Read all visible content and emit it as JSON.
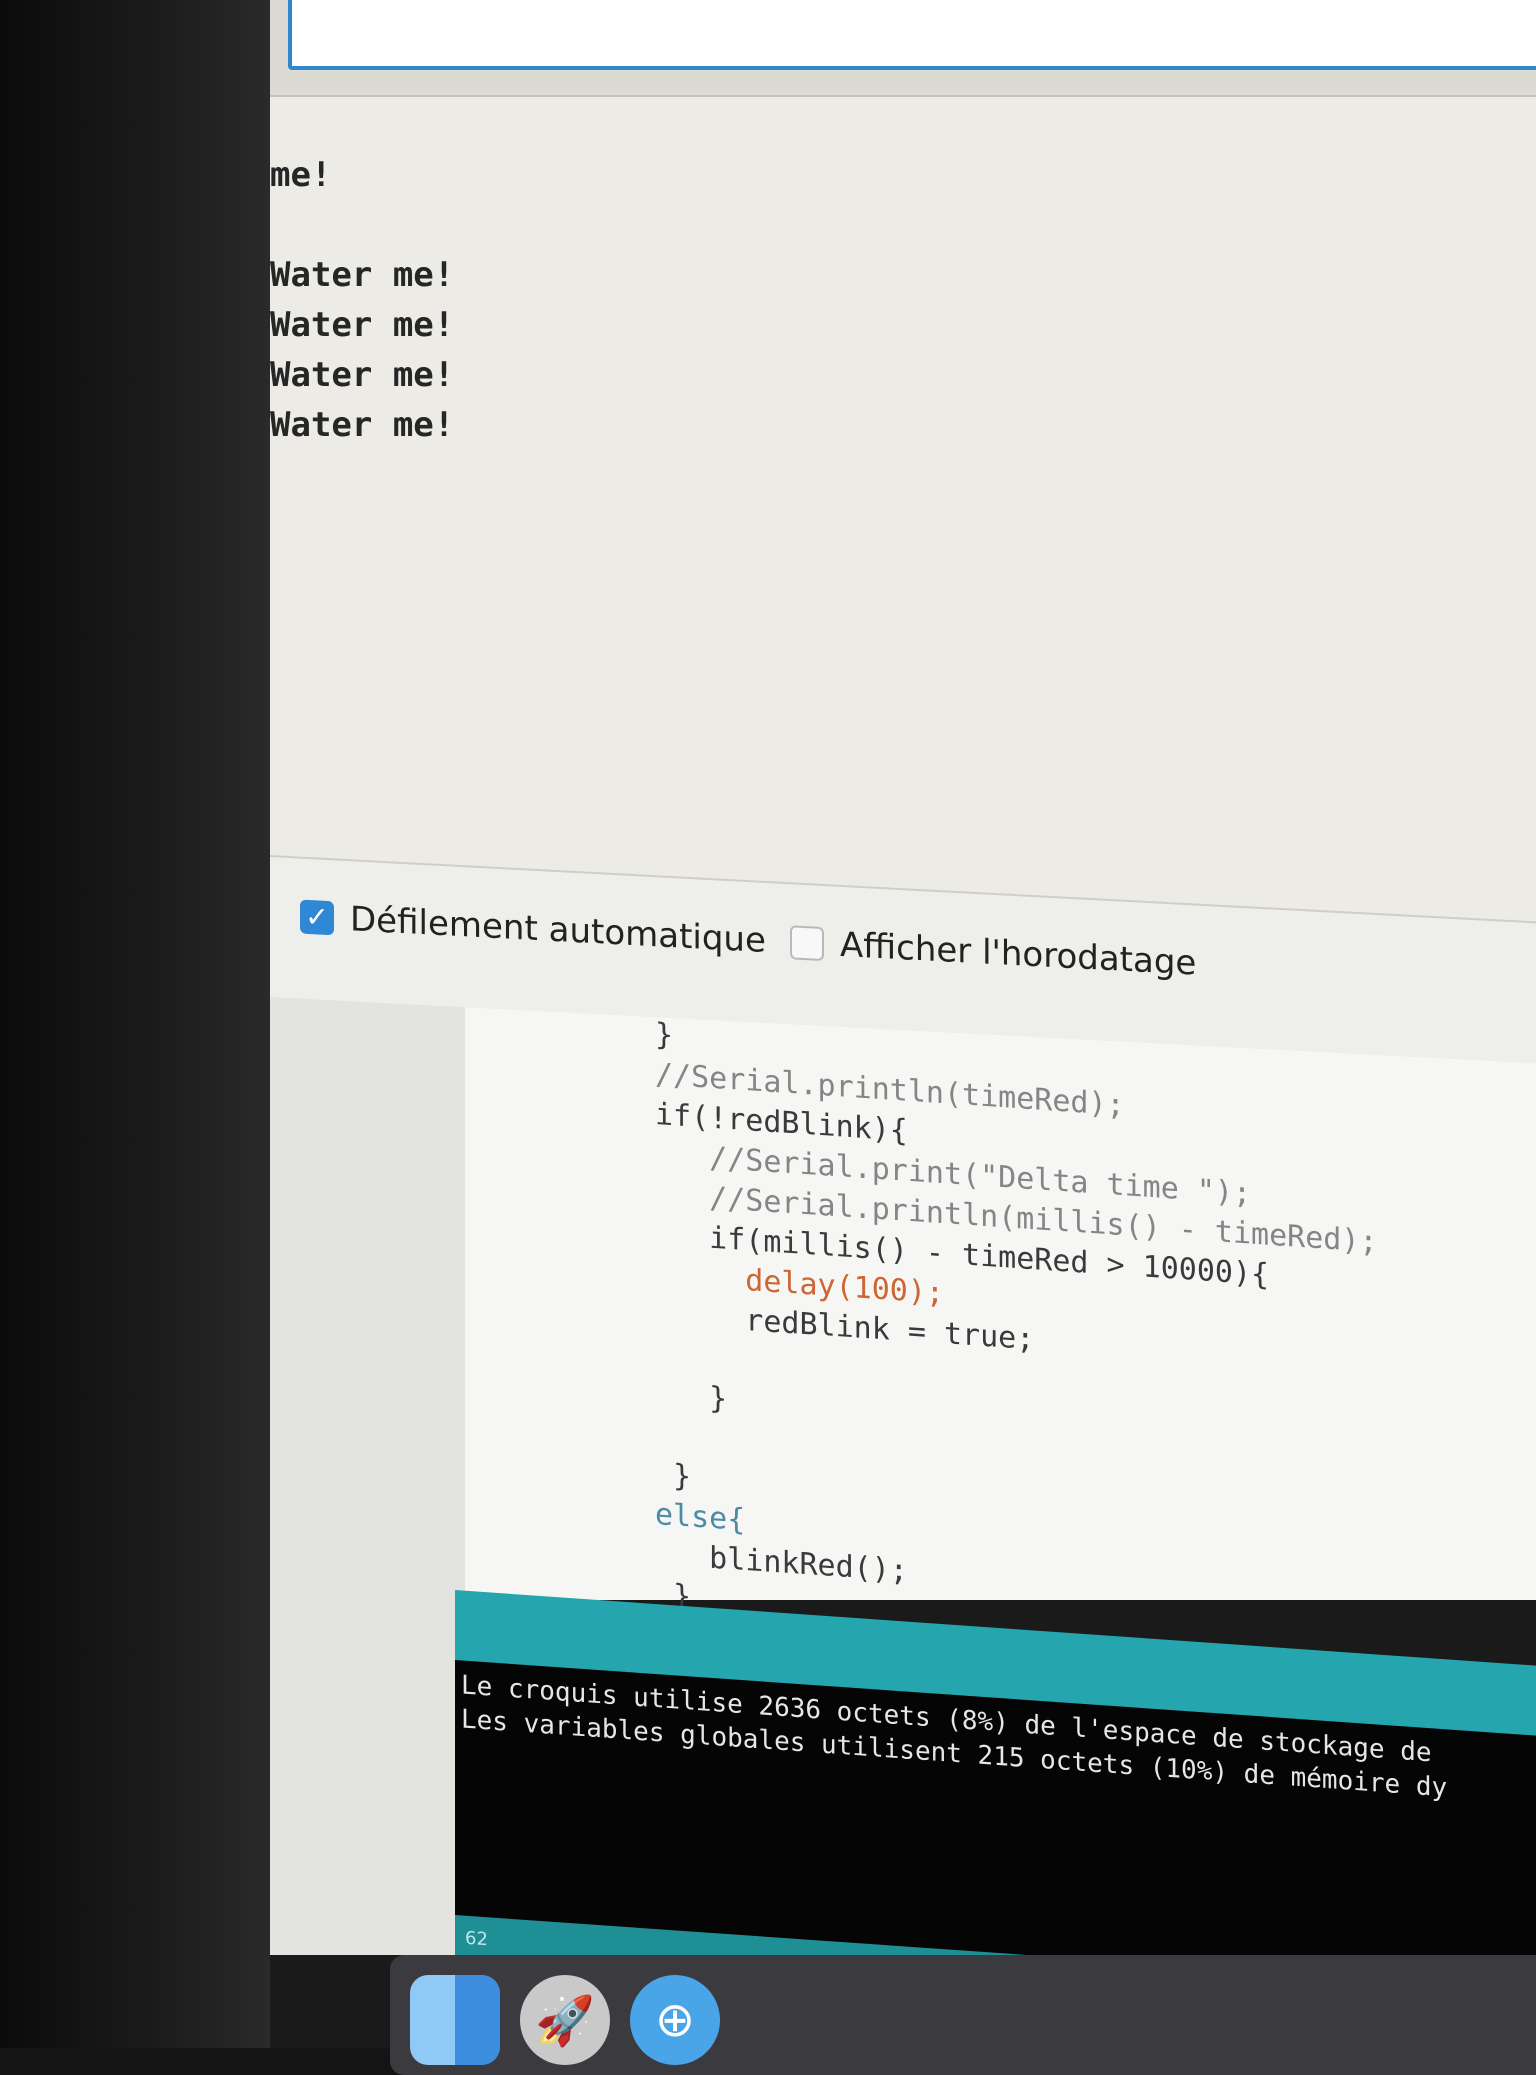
{
  "serial_monitor": {
    "output_lines": [
      "me!",
      "",
      "Water me!",
      "Water me!",
      "Water me!",
      "Water me!"
    ],
    "autoscroll": {
      "label": "Défilement automatique",
      "checked": true
    },
    "timestamp": {
      "label": "Afficher l'horodatage",
      "checked": false
    }
  },
  "editor": {
    "code_lines": [
      "}",
      "//Serial.println(timeRed);",
      "if(!redBlink){",
      "   //Serial.print(\"Delta time \");",
      "   //Serial.println(millis() - timeRed);",
      "   if(millis() - timeRed > 10000){",
      "     delay(100);",
      "     redBlink = true;",
      "",
      "   }",
      "",
      " }",
      "else{",
      "   blinkRed();",
      " }"
    ]
  },
  "console": {
    "lines": [
      "Le croquis utilise 2636 octets (8%) de l'espace de stockage de",
      "Les variables globales utilisent 215 octets (10%) de mémoire dy"
    ],
    "line_number": "62"
  },
  "dock": {
    "icons": [
      "finder-icon",
      "launchpad-icon",
      "safari-icon"
    ]
  }
}
